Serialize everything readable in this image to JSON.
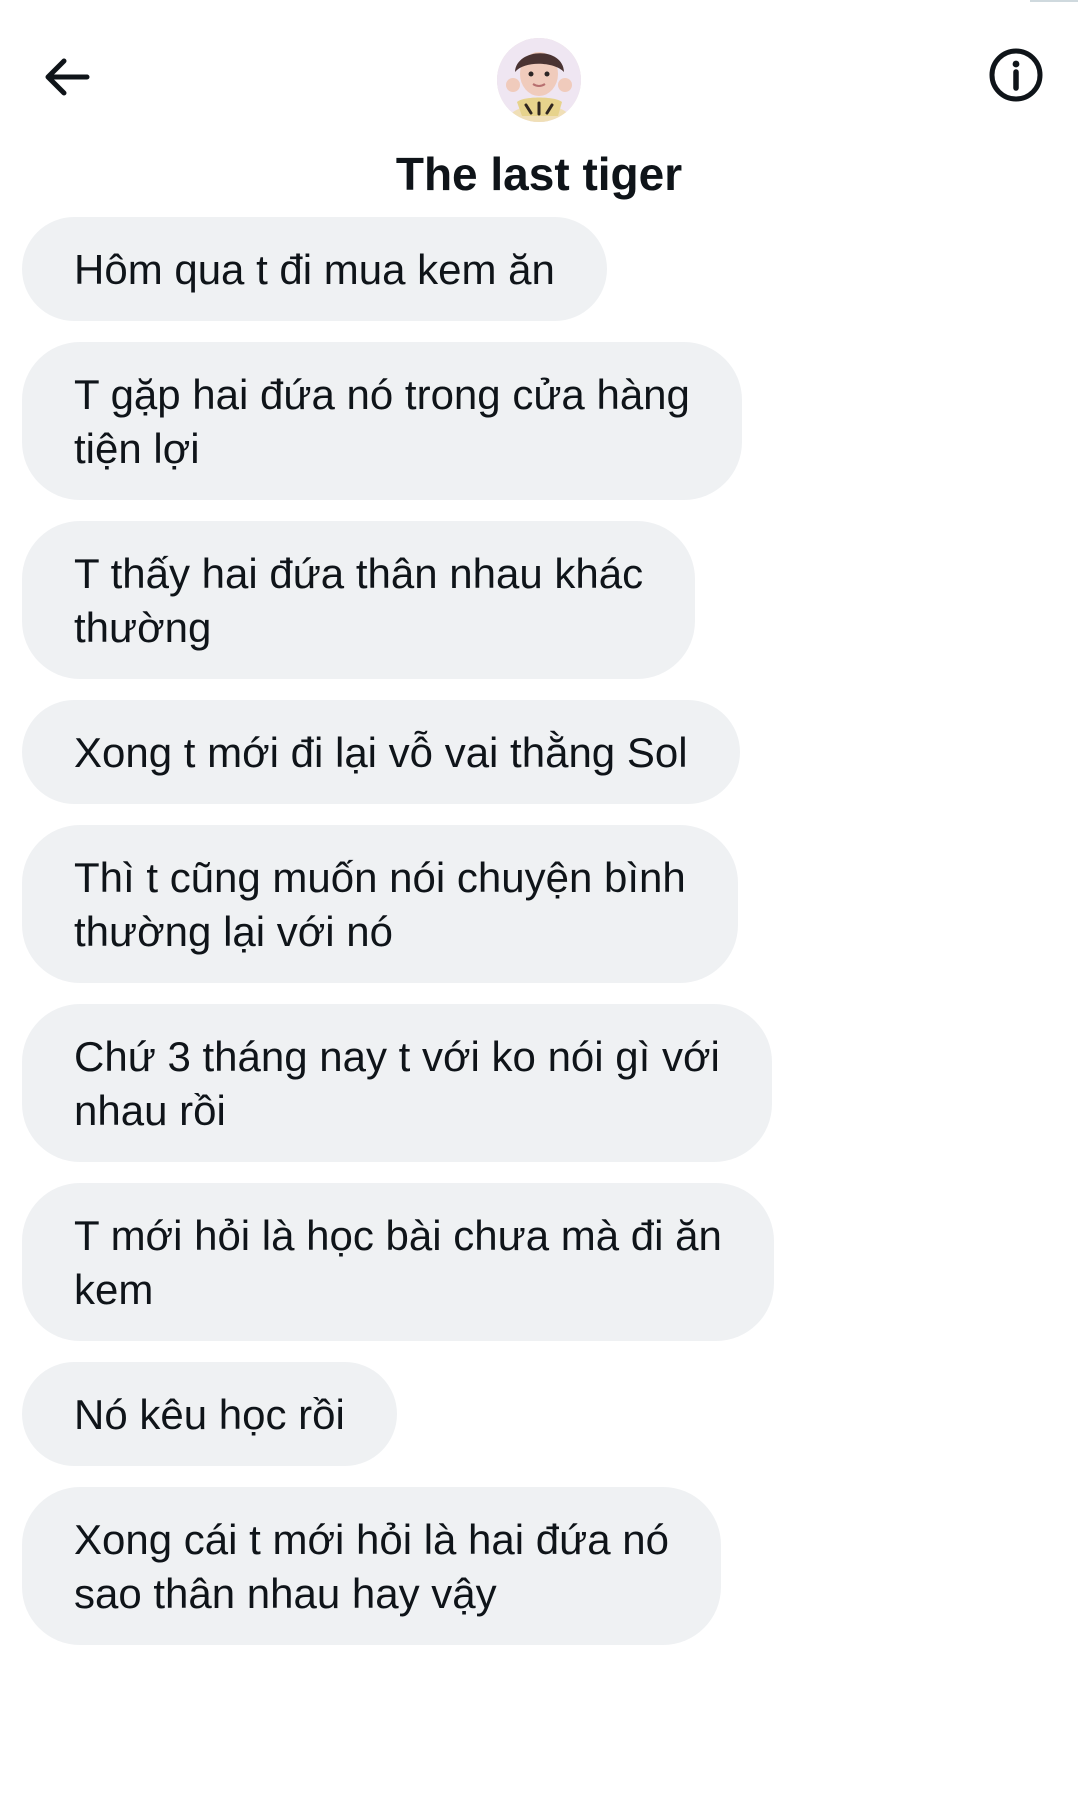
{
  "header": {
    "title": "The last tiger",
    "back_icon": "arrow-left-icon",
    "info_icon": "info-circle-icon",
    "avatar_icon": "profile-avatar"
  },
  "messages": [
    {
      "text": "Hôm qua t đi mua kem ăn"
    },
    {
      "text": "T gặp hai đứa nó trong cửa hàng\ntiện lợi"
    },
    {
      "text": "T thấy hai đứa thân nhau khác\nthường"
    },
    {
      "text": "Xong t mới đi lại vỗ vai thằng Sol"
    },
    {
      "text": "Thì t cũng muốn nói chuyện bình\nthường lại với nó"
    },
    {
      "text": "Chứ 3 tháng nay t với ko nói gì với\nnhau rồi"
    },
    {
      "text": "T mới hỏi là học bài chưa mà đi ăn\nkem"
    },
    {
      "text": "Nó kêu học rồi"
    },
    {
      "text": "Xong cái t mới hỏi là hai đứa nó\nsao thân nhau hay vậy"
    }
  ],
  "colors": {
    "bubble_background": "#eff1f3",
    "text": "#0f1419"
  }
}
